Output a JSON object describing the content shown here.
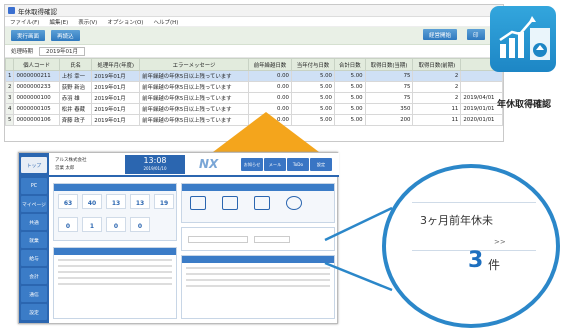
{
  "window": {
    "title": "年休取得確認",
    "menu": [
      "ファイル(F)",
      "編集(E)",
      "表示(V)",
      "オプション(O)",
      "ヘルプ(H)"
    ],
    "toolbar": {
      "btn1": "実行画面",
      "btn2": "再読込",
      "btn3": "経営開始",
      "btn4": "印"
    },
    "filter": {
      "label": "処理時期",
      "value": "2019年01月"
    }
  },
  "table": {
    "headers": [
      "個人コード",
      "氏名",
      "処理年月(年度)",
      "エラーメッセージ",
      "前年繰越日数",
      "当年付与日数",
      "合計日数",
      "取得日数(当期)",
      "取得日数(前期)",
      ""
    ],
    "rows": [
      {
        "n": "1",
        "code": "0000000211",
        "name": "上杉 幸一",
        "ym": "2019年01月",
        "msg": "前年繰越の年休5日以上残っています",
        "a": "0.00",
        "b": "5.00",
        "c": "5.00",
        "d": "75",
        "e": "2",
        "f": ""
      },
      {
        "n": "2",
        "code": "0000000233",
        "name": "荻野 新治",
        "ym": "2019年01月",
        "msg": "前年繰越の年休5日以上残っています",
        "a": "0.00",
        "b": "5.00",
        "c": "5.00",
        "d": "75",
        "e": "2",
        "f": ""
      },
      {
        "n": "3",
        "code": "0000000100",
        "name": "赤羽 雄",
        "ym": "2019年01月",
        "msg": "前年繰越の年休5日以上残っています",
        "a": "0.00",
        "b": "5.00",
        "c": "5.00",
        "d": "75",
        "e": "2",
        "f": "2019/04/01"
      },
      {
        "n": "4",
        "code": "0000000105",
        "name": "松井 春蔵",
        "ym": "2019年01月",
        "msg": "前年繰越の年休5日以上残っています",
        "a": "0.00",
        "b": "5.00",
        "c": "5.00",
        "d": "350",
        "e": "11",
        "f": "2019/01/01"
      },
      {
        "n": "5",
        "code": "0000000106",
        "name": "斉藤 政子",
        "ym": "2019年01月",
        "msg": "前年繰越の年休5日以上残っています",
        "a": "0.00",
        "b": "5.00",
        "c": "5.00",
        "d": "200",
        "e": "11",
        "f": "2020/01/01"
      }
    ]
  },
  "app_icon": {
    "label": "年休取得確認"
  },
  "screen": {
    "company": "アルス株式会社",
    "user": "営業 太郎",
    "clock": "13:08",
    "date": "2019/01/10",
    "brand": "NX",
    "header_buttons": [
      "お知らせ",
      "メール",
      "ToDo",
      "設定",
      "ヘルプ"
    ],
    "sidebar": [
      "トップ",
      "PC",
      "マイページ",
      "共通",
      "就業",
      "給与",
      "会計",
      "通信",
      "設定"
    ],
    "stats1": [
      "63",
      "40",
      "13",
      "13",
      "19"
    ],
    "stats2": [
      "0",
      "1",
      "0",
      "0"
    ]
  },
  "magnifier": {
    "label": "3ヶ月前年休未",
    "more": ">>",
    "count": "3",
    "unit": "件"
  },
  "colors": {
    "accent": "#2b87c9",
    "orange": "#f4a51c",
    "nav": "#2b66b0"
  }
}
